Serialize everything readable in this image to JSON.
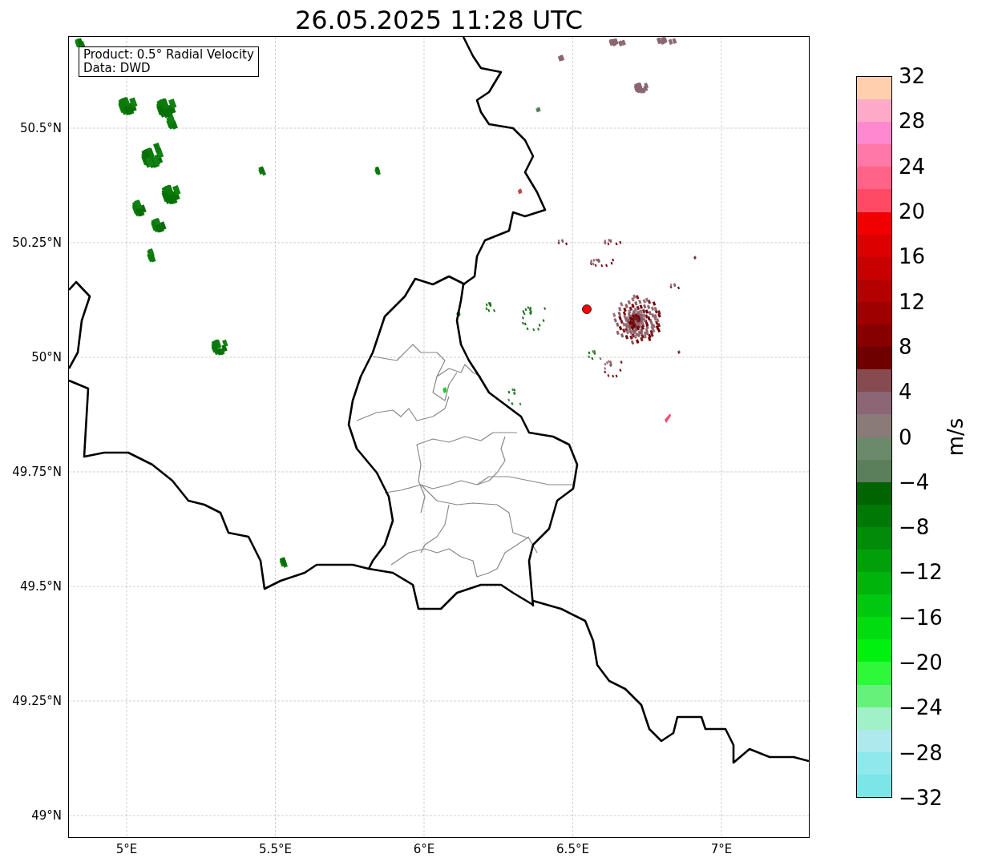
{
  "title": "26.05.2025 11:28 UTC",
  "info_box": [
    "Product: 0.5° Radial Velocity",
    "Data: DWD"
  ],
  "y_ticks": [
    "50.5°N",
    "50.25°N",
    "50°N",
    "49.75°N",
    "49.5°N",
    "49.25°N",
    "49°N"
  ],
  "x_ticks": [
    "5°E",
    "5.5°E",
    "6°E",
    "6.5°E",
    "7°E"
  ],
  "colorbar": {
    "label": "m/s",
    "ticks": [
      "32",
      "28",
      "24",
      "20",
      "16",
      "12",
      "8",
      "4",
      "0",
      "−4",
      "−8",
      "−12",
      "−16",
      "−20",
      "−24",
      "−28",
      "−32"
    ],
    "bands": [
      {
        "color": "#ffcfae"
      },
      {
        "color": "#ffaac8"
      },
      {
        "color": "#ff88d0"
      },
      {
        "color": "#ff78a8"
      },
      {
        "color": "#ff6488"
      },
      {
        "color": "#ff4a66"
      },
      {
        "color": "#f00000"
      },
      {
        "color": "#dc0000"
      },
      {
        "color": "#c80000"
      },
      {
        "color": "#b40000"
      },
      {
        "color": "#9e0000"
      },
      {
        "color": "#860000"
      },
      {
        "color": "#6e0000"
      },
      {
        "color": "#864a50"
      },
      {
        "color": "#8c6674"
      },
      {
        "color": "#8a7a78"
      },
      {
        "color": "#6b8a6b"
      },
      {
        "color": "#5a7f5a"
      },
      {
        "color": "#006400"
      },
      {
        "color": "#007806"
      },
      {
        "color": "#008c08"
      },
      {
        "color": "#00a00a"
      },
      {
        "color": "#00b40c"
      },
      {
        "color": "#00c810"
      },
      {
        "color": "#00dc10"
      },
      {
        "color": "#00f010"
      },
      {
        "color": "#2ef83a"
      },
      {
        "color": "#66f27a"
      },
      {
        "color": "#a0f0c8"
      },
      {
        "color": "#aee9ee"
      },
      {
        "color": "#8ee8ec"
      },
      {
        "color": "#7be5e8"
      }
    ]
  }
}
